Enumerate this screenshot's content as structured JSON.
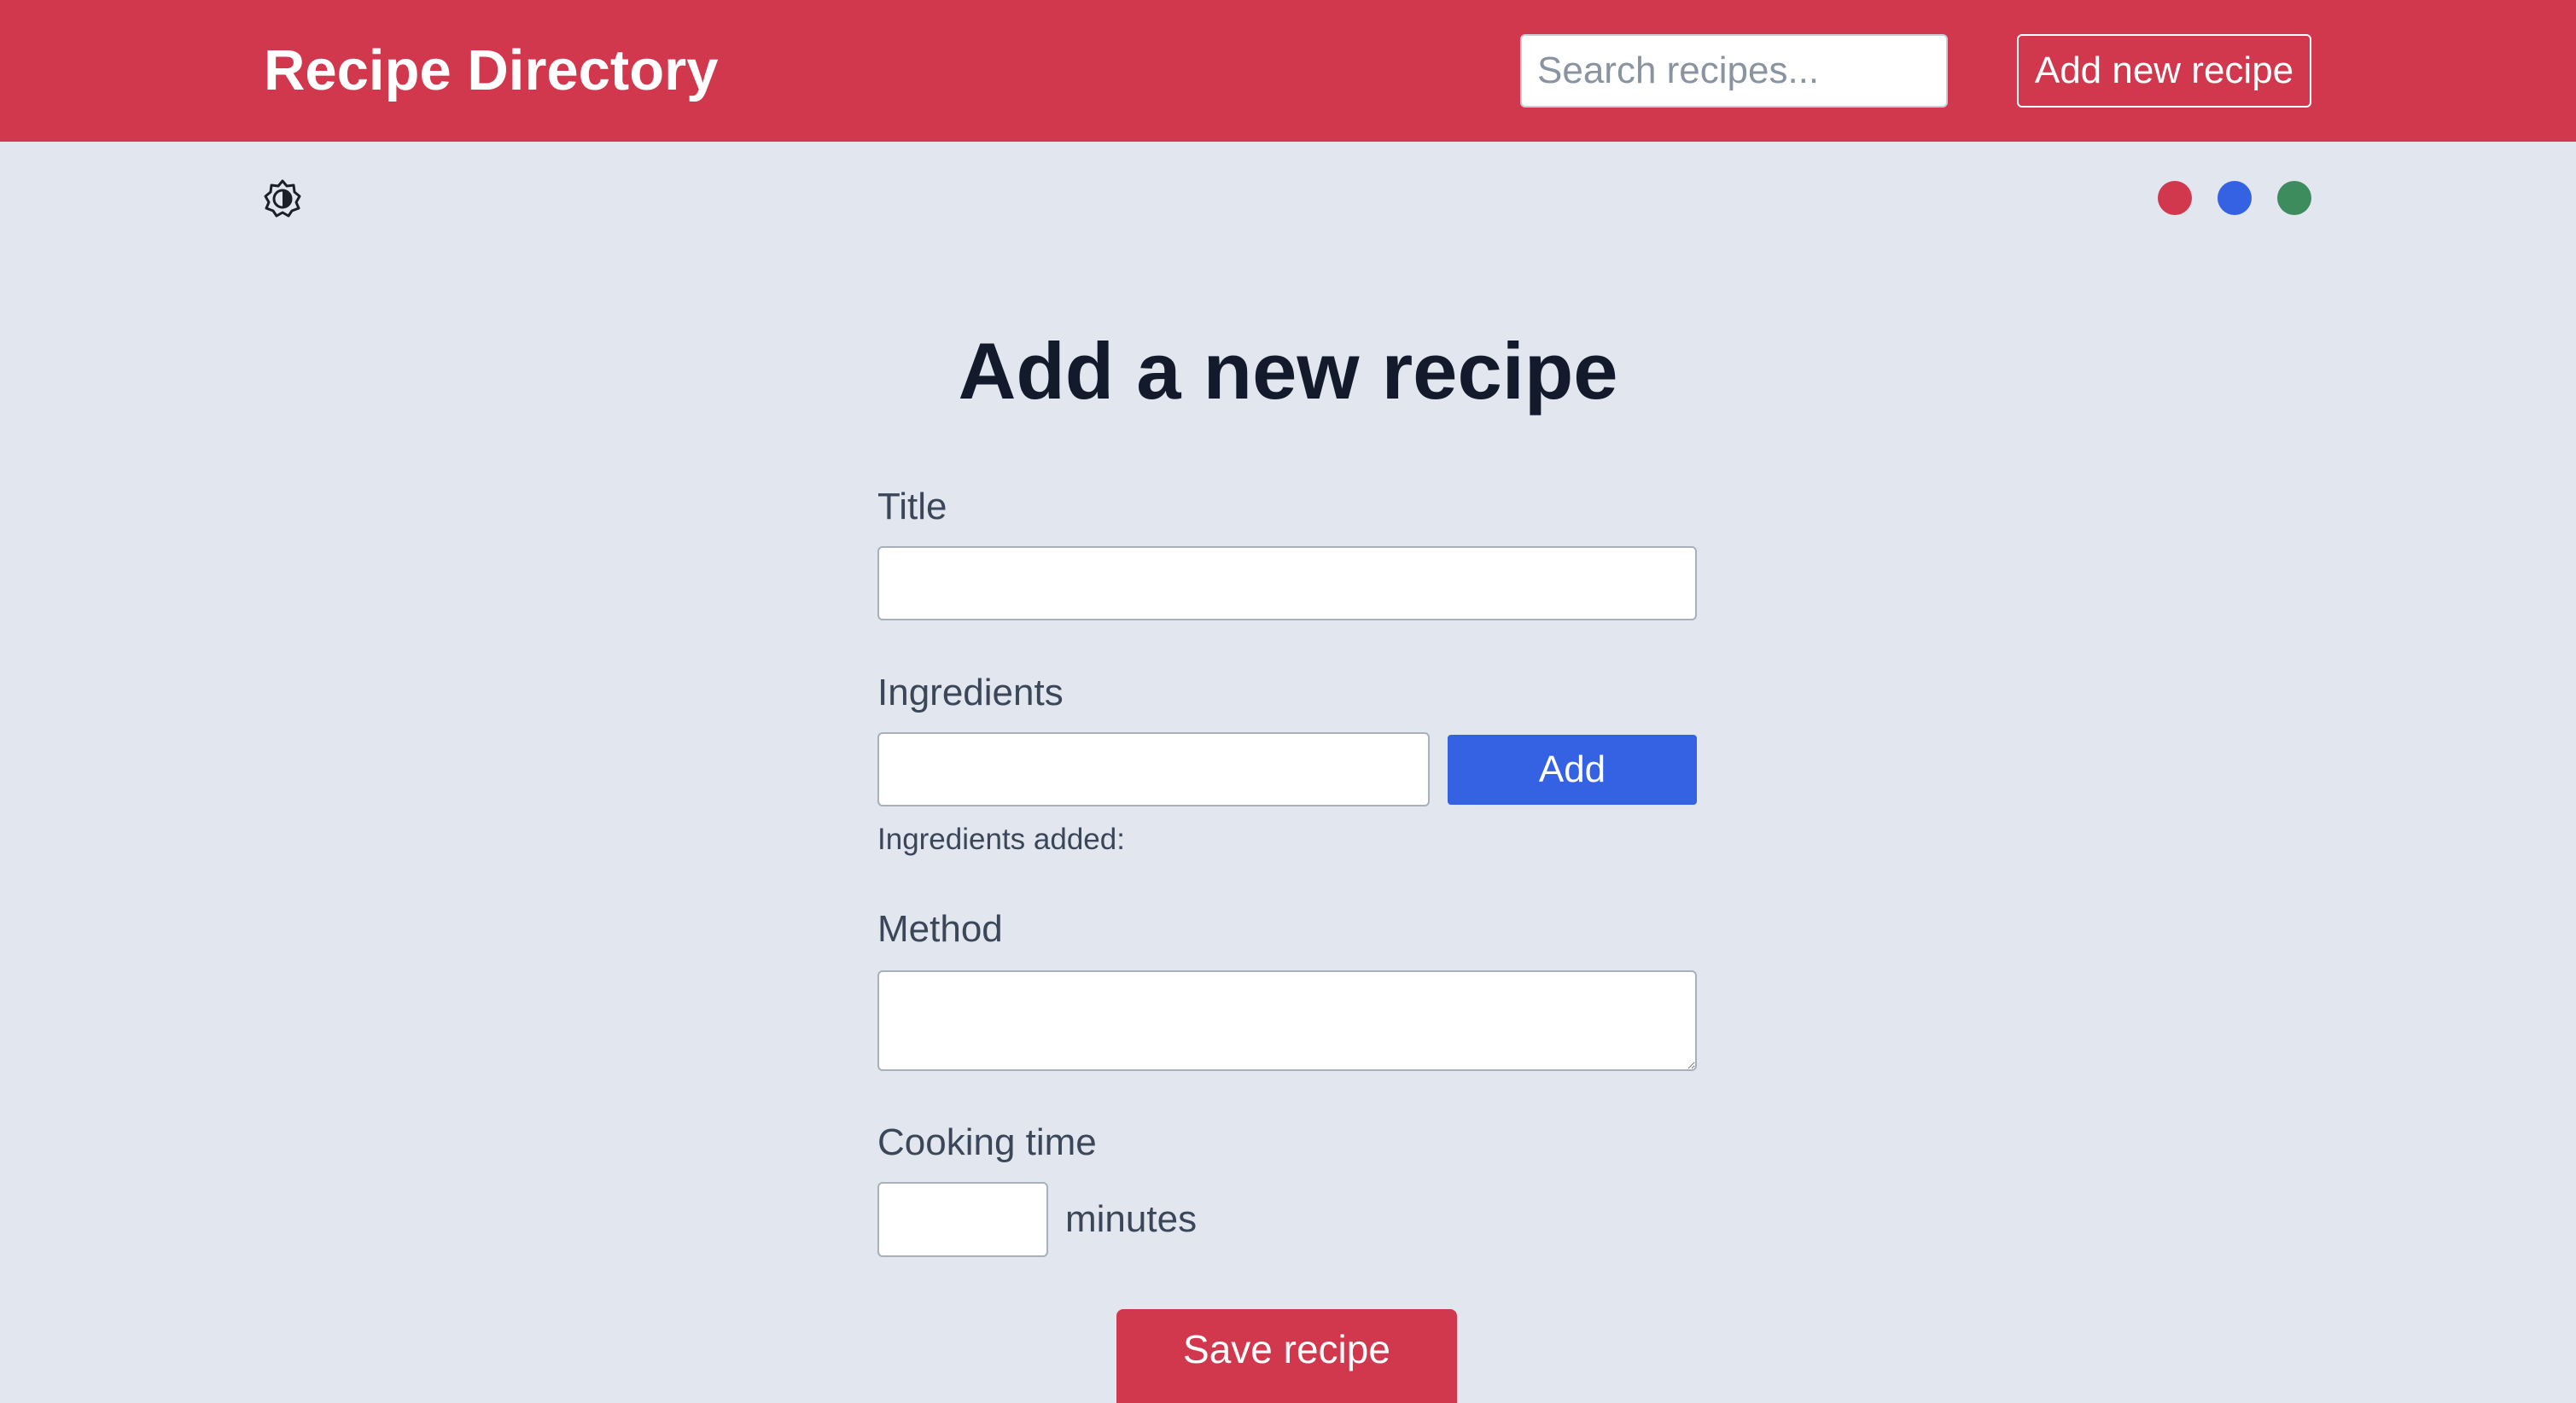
{
  "header": {
    "brand": "Recipe Directory",
    "search_placeholder": "Search recipes...",
    "add_new_label": "Add new recipe",
    "background_color": "#d1374d"
  },
  "toolbar": {
    "theme_toggle_icon": "brightness-contrast-icon",
    "color_swatches": [
      {
        "name": "red",
        "color": "#d1374d"
      },
      {
        "name": "blue",
        "color": "#3562e3"
      },
      {
        "name": "green",
        "color": "#3d8c5d"
      }
    ]
  },
  "form": {
    "heading": "Add a new recipe",
    "title_label": "Title",
    "title_value": "",
    "ingredients_label": "Ingredients",
    "ingredient_value": "",
    "add_button_label": "Add",
    "ingredients_added_label": "Ingredients added:",
    "method_label": "Method",
    "method_value": "",
    "cooking_time_label": "Cooking time",
    "cooking_time_value": "",
    "cooking_time_unit": "minutes",
    "save_button_label": "Save recipe"
  }
}
